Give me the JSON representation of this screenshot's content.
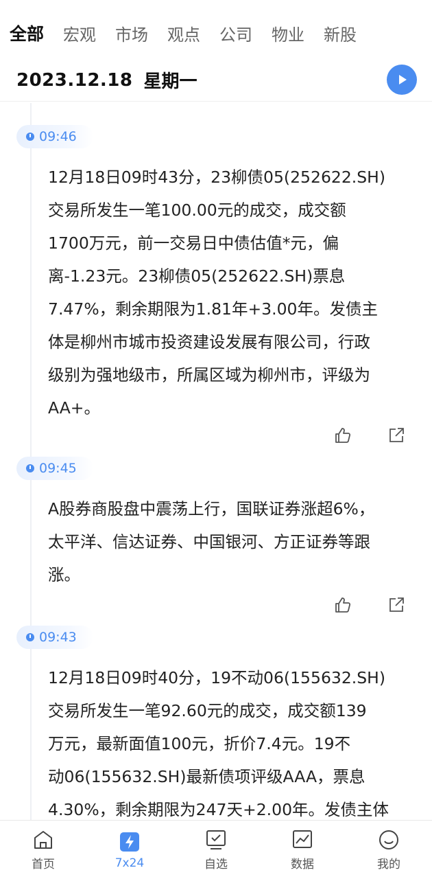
{
  "tabs": [
    {
      "label": "全部",
      "active": true
    },
    {
      "label": "宏观",
      "active": false
    },
    {
      "label": "市场",
      "active": false
    },
    {
      "label": "观点",
      "active": false
    },
    {
      "label": "公司",
      "active": false
    },
    {
      "label": "物业",
      "active": false
    },
    {
      "label": "新股",
      "active": false
    }
  ],
  "date_bar": {
    "date": "2023.12.18",
    "weekday": "星期一",
    "play_icon": "play-icon"
  },
  "feed": [
    {
      "time": "09:46",
      "text": "12月18日09时43分，23柳债05(252622.SH)\n交易所发生一笔100.00元的成交，成交额\n1700万元，前一交易日中债估值*元，偏\n离-1.23元。23柳债05(252622.SH)票息\n7.47%，剩余期限为1.81年+3.00年。发债主\n体是柳州市城市投资建设发展有限公司，行政\n级别为强地级市，所属区域为柳州市，评级为\nAA+。"
    },
    {
      "time": "09:45",
      "text": "A股券商股盘中震荡上行，国联证券涨超6%，\n太平洋、信达证券、中国银河、方正证券等跟\n涨。"
    },
    {
      "time": "09:43",
      "text": "12月18日09时40分，19不动06(155632.SH)\n交易所发生一笔92.60元的成交，成交额139\n万元，最新面值100元，折价7.4元。19不\n动06(155632.SH)最新债项评级AAA，票息\n4.30%，剩余期限为247天+2.00年。发债主体"
    }
  ],
  "bottom_nav": [
    {
      "label": "首页",
      "icon": "home-icon",
      "active": false
    },
    {
      "label": "7x24",
      "icon": "flash-icon",
      "active": true
    },
    {
      "label": "自选",
      "icon": "watchlist-icon",
      "active": false
    },
    {
      "label": "数据",
      "icon": "chart-icon",
      "active": false
    },
    {
      "label": "我的",
      "icon": "profile-icon",
      "active": false
    }
  ],
  "colors": {
    "accent": "#4a8cf0",
    "text": "#222222",
    "muted": "#666666"
  }
}
